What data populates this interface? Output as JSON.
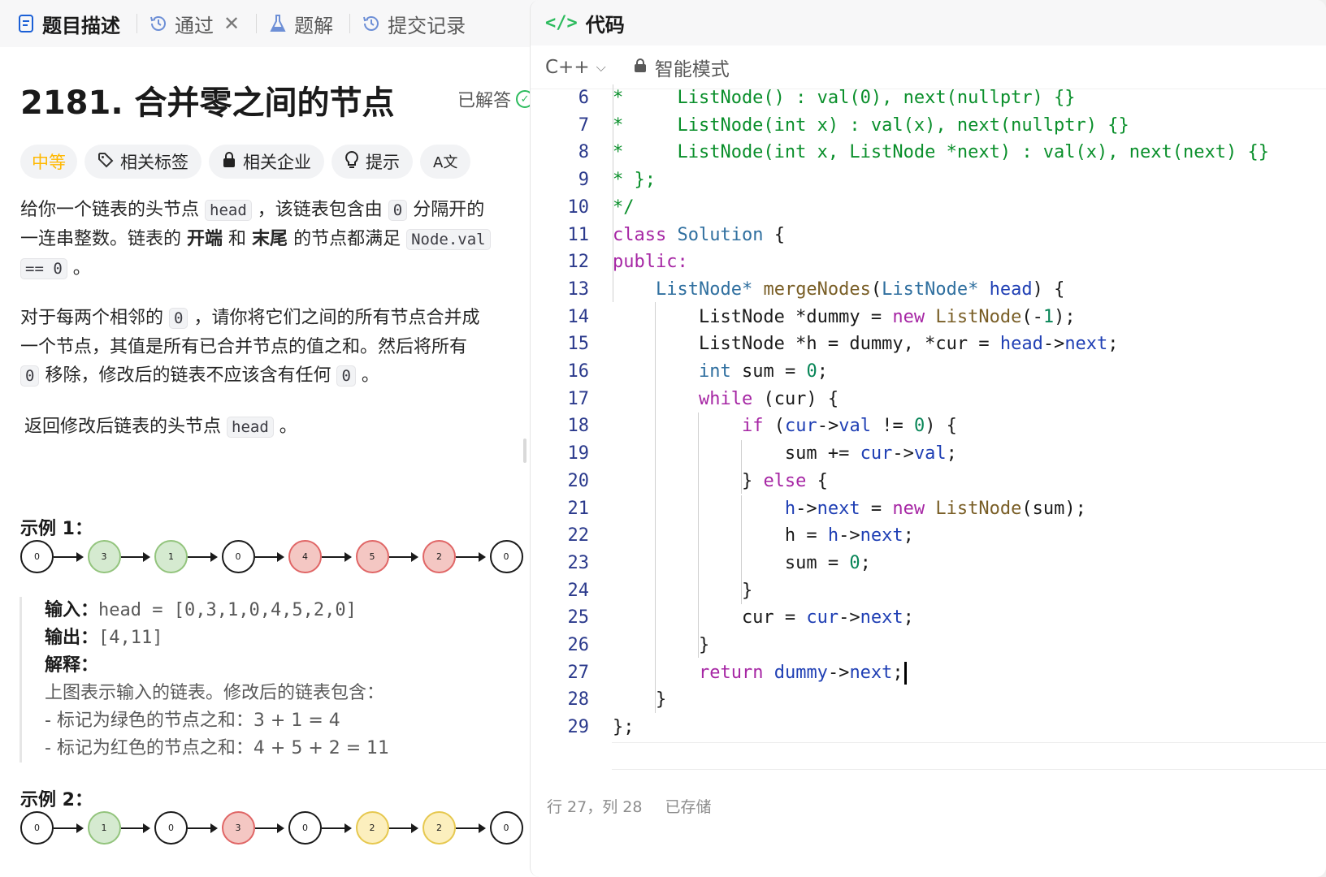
{
  "left_tabs": [
    {
      "label": "题目描述",
      "icon": "doc-icon",
      "active": true
    },
    {
      "label": "通过",
      "icon": "history-icon",
      "closable": true
    },
    {
      "label": "题解",
      "icon": "flask-icon"
    },
    {
      "label": "提交记录",
      "icon": "history-icon"
    }
  ],
  "problem": {
    "title": "2181. 合并零之间的节点",
    "status": "已解答",
    "difficulty": "中等",
    "chips": [
      "相关标签",
      "相关企业",
      "提示"
    ],
    "translate_glyph": "A文"
  },
  "description": {
    "p1_a": "给你一个链表的头节点",
    "p1_code1": "head",
    "p1_b": "，该链表包含由",
    "p1_code2": "0",
    "p1_c": "分隔开的",
    "p1_d": "一连串整数。链表的",
    "p1_bold1": "开端",
    "p1_e": "和",
    "p1_bold2": "末尾",
    "p1_f": "的节点都满足",
    "p1_code3": "Node.val",
    "p1_code4": "== 0",
    "p1_g": "。",
    "p2_a": "对于每两个相邻的",
    "p2_code1": "0",
    "p2_b": "，请你将它们之间的所有节点合并成",
    "p2_c": "一个节点，其值是所有已合并节点的值之和。然后将所有",
    "p2_code2": "0",
    "p2_d": "移除，修改后的链表不应该含有任何",
    "p2_code3": "0",
    "p2_e": "。",
    "p3_a": "返回修改后链表的头节点",
    "p3_code": "head",
    "p3_b": "。"
  },
  "example1": {
    "title": "示例 1：",
    "nodes": [
      {
        "v": "0",
        "c": ""
      },
      {
        "v": "3",
        "c": "green"
      },
      {
        "v": "1",
        "c": "green"
      },
      {
        "v": "0",
        "c": ""
      },
      {
        "v": "4",
        "c": "red"
      },
      {
        "v": "5",
        "c": "red"
      },
      {
        "v": "2",
        "c": "red"
      },
      {
        "v": "0",
        "c": ""
      }
    ],
    "input_label": "输入：",
    "input_value": "head = [0,3,1,0,4,5,2,0]",
    "output_label": "输出：",
    "output_value": "[4,11]",
    "explain_label": "解释：",
    "explain_1": "上图表示输入的链表。修改后的链表包含：",
    "explain_2": "- 标记为绿色的节点之和：3 + 1 = 4",
    "explain_3": "- 标记为红色的节点之和：4 + 5 + 2 = 11"
  },
  "example2": {
    "title": "示例 2：",
    "nodes": [
      {
        "v": "0",
        "c": ""
      },
      {
        "v": "1",
        "c": "green"
      },
      {
        "v": "0",
        "c": ""
      },
      {
        "v": "3",
        "c": "red"
      },
      {
        "v": "0",
        "c": ""
      },
      {
        "v": "2",
        "c": "yellow"
      },
      {
        "v": "2",
        "c": "yellow"
      },
      {
        "v": "0",
        "c": ""
      }
    ]
  },
  "editor": {
    "header": "代码",
    "language": "C++",
    "mode": "智能模式",
    "status_pos": "行 27，列 28",
    "status_saved": "已存储",
    "lines": [
      {
        "n": "6",
        "tokens": [
          [
            "g",
            "*     ListNode() : val(0), next(nullptr) {}"
          ]
        ]
      },
      {
        "n": "7",
        "tokens": [
          [
            "g",
            "*     ListNode(int x) : val(x), next(nullptr) {}"
          ]
        ]
      },
      {
        "n": "8",
        "tokens": [
          [
            "g",
            "*     ListNode(int x, ListNode *next) : val(x), next(next) {}"
          ]
        ]
      },
      {
        "n": "9",
        "tokens": [
          [
            "g",
            "* };"
          ]
        ]
      },
      {
        "n": "10",
        "tokens": [
          [
            "g",
            "*/"
          ]
        ]
      },
      {
        "n": "11",
        "tokens": [
          [
            "k",
            "class"
          ],
          [
            "o",
            " "
          ],
          [
            "t",
            "Solution"
          ],
          [
            "o",
            " {"
          ]
        ]
      },
      {
        "n": "12",
        "tokens": [
          [
            "k",
            "public:"
          ]
        ]
      },
      {
        "n": "13",
        "tokens": [
          [
            "o",
            "    "
          ],
          [
            "t",
            "ListNode*"
          ],
          [
            "o",
            " "
          ],
          [
            "f",
            "mergeNodes"
          ],
          [
            "o",
            "("
          ],
          [
            "t",
            "ListNode*"
          ],
          [
            "o",
            " "
          ],
          [
            "v",
            "head"
          ],
          [
            "o",
            ") {"
          ]
        ]
      },
      {
        "n": "14",
        "tokens": [
          [
            "o",
            "        ListNode *dummy = "
          ],
          [
            "k",
            "new"
          ],
          [
            "o",
            " "
          ],
          [
            "f",
            "ListNode"
          ],
          [
            "o",
            "(-"
          ],
          [
            "n",
            "1"
          ],
          [
            "o",
            ");"
          ]
        ]
      },
      {
        "n": "15",
        "tokens": [
          [
            "o",
            "        ListNode *h = dummy, *cur = "
          ],
          [
            "v",
            "head"
          ],
          [
            "o",
            "->"
          ],
          [
            "v",
            "next"
          ],
          [
            "o",
            ";"
          ]
        ]
      },
      {
        "n": "16",
        "tokens": [
          [
            "o",
            "        "
          ],
          [
            "t",
            "int"
          ],
          [
            "o",
            " sum = "
          ],
          [
            "n",
            "0"
          ],
          [
            "o",
            ";"
          ]
        ]
      },
      {
        "n": "17",
        "tokens": [
          [
            "o",
            "        "
          ],
          [
            "k",
            "while"
          ],
          [
            "o",
            " (cur) {"
          ]
        ]
      },
      {
        "n": "18",
        "tokens": [
          [
            "o",
            "            "
          ],
          [
            "k",
            "if"
          ],
          [
            "o",
            " ("
          ],
          [
            "v",
            "cur"
          ],
          [
            "o",
            "->"
          ],
          [
            "v",
            "val"
          ],
          [
            "o",
            " != "
          ],
          [
            "n",
            "0"
          ],
          [
            "o",
            ") {"
          ]
        ]
      },
      {
        "n": "19",
        "tokens": [
          [
            "o",
            "                sum += "
          ],
          [
            "v",
            "cur"
          ],
          [
            "o",
            "->"
          ],
          [
            "v",
            "val"
          ],
          [
            "o",
            ";"
          ]
        ]
      },
      {
        "n": "20",
        "tokens": [
          [
            "o",
            "            } "
          ],
          [
            "k",
            "else"
          ],
          [
            "o",
            " {"
          ]
        ]
      },
      {
        "n": "21",
        "tokens": [
          [
            "o",
            "                "
          ],
          [
            "v",
            "h"
          ],
          [
            "o",
            "->"
          ],
          [
            "v",
            "next"
          ],
          [
            "o",
            " = "
          ],
          [
            "k",
            "new"
          ],
          [
            "o",
            " "
          ],
          [
            "f",
            "ListNode"
          ],
          [
            "o",
            "(sum);"
          ]
        ]
      },
      {
        "n": "22",
        "tokens": [
          [
            "o",
            "                h = "
          ],
          [
            "v",
            "h"
          ],
          [
            "o",
            "->"
          ],
          [
            "v",
            "next"
          ],
          [
            "o",
            ";"
          ]
        ]
      },
      {
        "n": "23",
        "tokens": [
          [
            "o",
            "                sum = "
          ],
          [
            "n",
            "0"
          ],
          [
            "o",
            ";"
          ]
        ]
      },
      {
        "n": "24",
        "tokens": [
          [
            "o",
            "            }"
          ]
        ]
      },
      {
        "n": "25",
        "tokens": [
          [
            "o",
            "            cur = "
          ],
          [
            "v",
            "cur"
          ],
          [
            "o",
            "->"
          ],
          [
            "v",
            "next"
          ],
          [
            "o",
            ";"
          ]
        ]
      },
      {
        "n": "26",
        "tokens": [
          [
            "o",
            "        }"
          ]
        ]
      },
      {
        "n": "27",
        "tokens": [
          [
            "o",
            "        "
          ],
          [
            "k",
            "return"
          ],
          [
            "o",
            " "
          ],
          [
            "v",
            "dummy"
          ],
          [
            "o",
            "->"
          ],
          [
            "v",
            "next"
          ],
          [
            "o",
            ";"
          ]
        ],
        "caret": true
      },
      {
        "n": "28",
        "tokens": [
          [
            "o",
            "    }"
          ]
        ]
      },
      {
        "n": "29",
        "tokens": [
          [
            "o",
            "};"
          ]
        ]
      }
    ]
  }
}
